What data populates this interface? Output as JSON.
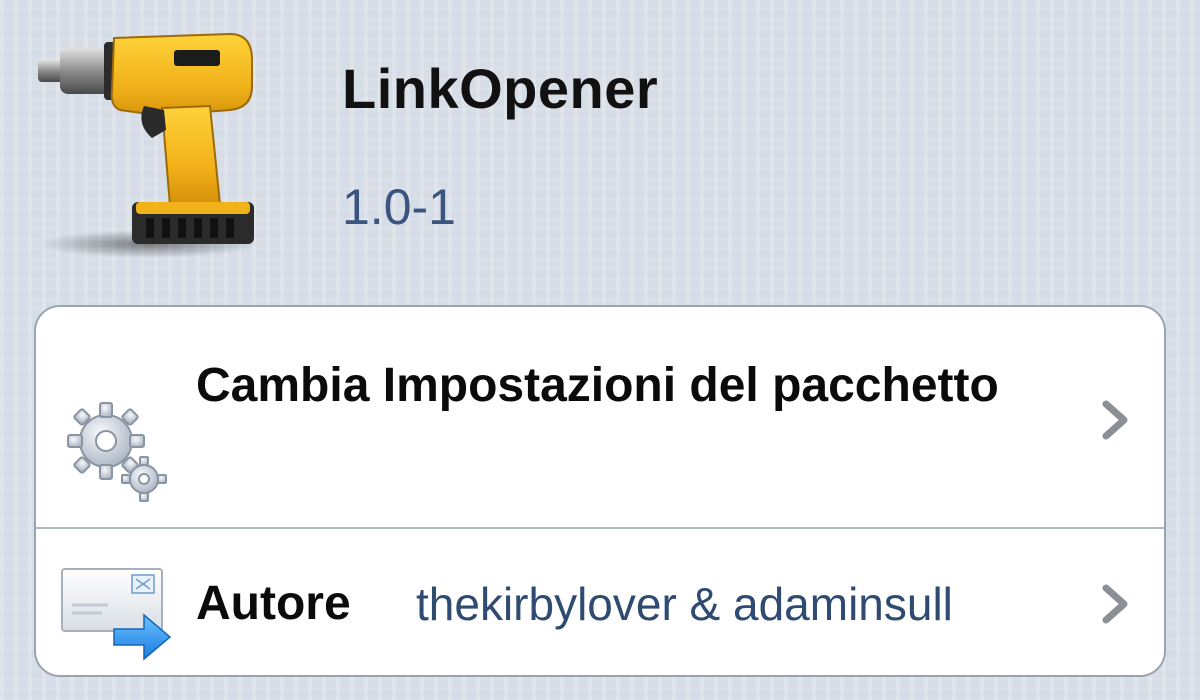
{
  "header": {
    "app_name": "LinkOpener",
    "version": "1.0-1",
    "icon": "power-drill-icon"
  },
  "rows": [
    {
      "label": "Cambia Impostazioni del pacchetto",
      "icon": "gears-icon",
      "accessory": "chevron-right-icon"
    },
    {
      "label": "Autore",
      "value": "thekirbylover & adaminsull",
      "icon": "mail-forward-icon",
      "accessory": "chevron-right-icon"
    }
  ],
  "colors": {
    "background": "#d6dde6",
    "version_text": "#3a5580",
    "value_text": "#2f4b72",
    "chevron": "#8b8f96"
  }
}
